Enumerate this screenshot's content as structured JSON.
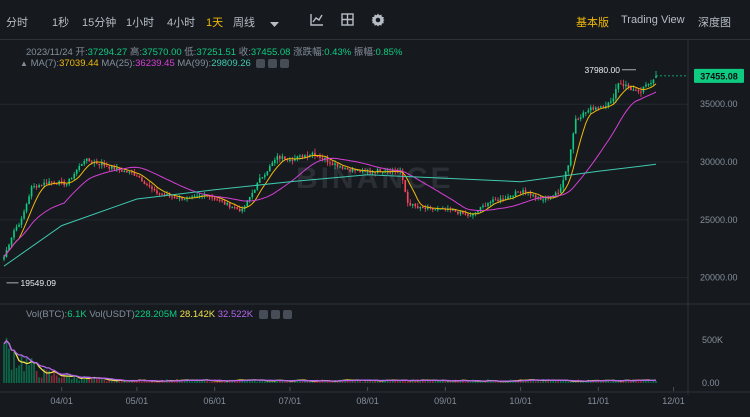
{
  "toolbar": {
    "intervals": [
      "分时",
      "1秒",
      "15分钟",
      "1小时",
      "4小时",
      "1天",
      "周线"
    ],
    "active_interval": "1天",
    "views": [
      "基本版",
      "Trading View",
      "深度图"
    ],
    "active_view": "基本版",
    "icons": [
      "chevron-down-icon",
      "indicator-icon",
      "grid-layout-icon",
      "settings-gear-icon"
    ]
  },
  "ohlc_line": {
    "date": "2023/11/24",
    "open_label": "开:",
    "open": "37294.27",
    "high_label": "高:",
    "high": "37570.00",
    "low_label": "低:",
    "low": "37251.51",
    "close_label": "收:",
    "close": "37455.08",
    "change_label": "涨跌幅:",
    "change": "0.43%",
    "amplitude_label": "振幅:",
    "amplitude": "0.85%"
  },
  "ma_line": {
    "ma7_label": "MA(7):",
    "ma7": "37039.44",
    "ma25_label": "MA(25):",
    "ma25": "36239.45",
    "ma99_label": "MA(99):",
    "ma99": "29809.26"
  },
  "vol_line": {
    "label": "Vol(BTC):",
    "btc": "6.1K",
    "usdt_label": "Vol(USDT)",
    "usdt": "228.205M",
    "v1": "28.142K",
    "v2": "32.522K"
  },
  "price_axis": [
    "35000.00",
    "30000.00",
    "25000.00",
    "20000.00"
  ],
  "volume_axis": [
    "500K",
    "0.00"
  ],
  "time_axis": [
    "04/01",
    "05/01",
    "06/01",
    "07/01",
    "08/01",
    "09/01",
    "10/01",
    "11/01",
    "12/01"
  ],
  "last_price_tag": "37455.08",
  "high_marker": "37980.00",
  "low_marker": "19549.09",
  "watermark": "BINANCE",
  "colors": {
    "up": "#0ecb81",
    "down": "#f6465d",
    "ma7": "#f0b90b",
    "ma25": "#d63fd6",
    "ma99": "#3fc9b0",
    "vol_ma1": "#f0e04d",
    "vol_ma2": "#b565f0",
    "active": "#f0b90b"
  },
  "chart_data": {
    "type": "candlestick",
    "price_range": [
      18500,
      39000
    ],
    "volume_range": [
      0,
      700000
    ],
    "x_start": "2023-03-09",
    "x_end": "2023-11-24",
    "weekly_closes": [
      [
        "2023-03-09",
        21800
      ],
      [
        "2023-03-13",
        24100
      ],
      [
        "2023-03-16",
        25000
      ],
      [
        "2023-03-20",
        27800
      ],
      [
        "2023-03-27",
        28300
      ],
      [
        "2023-04-03",
        28100
      ],
      [
        "2023-04-10",
        30200
      ],
      [
        "2023-04-17",
        29800
      ],
      [
        "2023-04-24",
        29300
      ],
      [
        "2023-05-01",
        28900
      ],
      [
        "2023-05-08",
        27400
      ],
      [
        "2023-05-15",
        27000
      ],
      [
        "2023-05-22",
        26800
      ],
      [
        "2023-05-29",
        27200
      ],
      [
        "2023-06-05",
        26400
      ],
      [
        "2023-06-12",
        25800
      ],
      [
        "2023-06-19",
        28500
      ],
      [
        "2023-06-26",
        30400
      ],
      [
        "2023-07-03",
        30300
      ],
      [
        "2023-07-10",
        30800
      ],
      [
        "2023-07-17",
        30000
      ],
      [
        "2023-07-24",
        29400
      ],
      [
        "2023-07-31",
        29100
      ],
      [
        "2023-08-07",
        29300
      ],
      [
        "2023-08-14",
        29200
      ],
      [
        "2023-08-17",
        26500
      ],
      [
        "2023-08-21",
        26000
      ],
      [
        "2023-08-28",
        25900
      ],
      [
        "2023-09-04",
        25800
      ],
      [
        "2023-09-11",
        25300
      ],
      [
        "2023-09-18",
        26500
      ],
      [
        "2023-09-25",
        26900
      ],
      [
        "2023-10-02",
        27600
      ],
      [
        "2023-10-09",
        26700
      ],
      [
        "2023-10-16",
        27300
      ],
      [
        "2023-10-20",
        29800
      ],
      [
        "2023-10-23",
        33800
      ],
      [
        "2023-10-30",
        34700
      ],
      [
        "2023-11-06",
        35100
      ],
      [
        "2023-11-09",
        36900
      ],
      [
        "2023-11-13",
        36500
      ],
      [
        "2023-11-17",
        35900
      ],
      [
        "2023-11-24",
        37455
      ]
    ],
    "ma99_points": [
      [
        "2023-03-09",
        21000
      ],
      [
        "2023-04-01",
        24500
      ],
      [
        "2023-05-01",
        26800
      ],
      [
        "2023-06-01",
        27600
      ],
      [
        "2023-07-01",
        28300
      ],
      [
        "2023-08-01",
        28900
      ],
      [
        "2023-09-01",
        28600
      ],
      [
        "2023-10-01",
        28300
      ],
      [
        "2023-11-01",
        29200
      ],
      [
        "2023-11-24",
        29809
      ]
    ],
    "high": {
      "date": "2023-11-16",
      "value": 37980.0
    },
    "low": {
      "date": "2023-03-10",
      "value": 19549.09
    },
    "last": 37455.08
  }
}
